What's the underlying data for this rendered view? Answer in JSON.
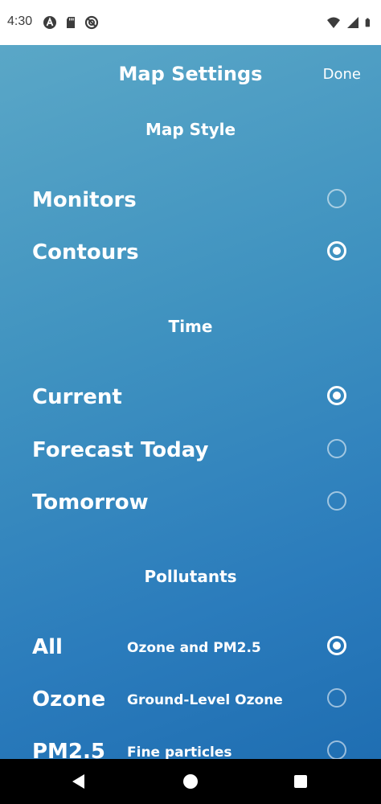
{
  "status_bar": {
    "time": "4:30",
    "left_icons": [
      "a-icon",
      "sd-card-icon",
      "sync-icon"
    ],
    "right_icons": [
      "wifi-icon",
      "signal-icon",
      "battery-icon"
    ]
  },
  "header": {
    "title": "Map Settings",
    "done_label": "Done"
  },
  "sections": {
    "map_style": {
      "title": "Map Style",
      "options": [
        {
          "label": "Monitors",
          "selected": false
        },
        {
          "label": "Contours",
          "selected": true
        }
      ]
    },
    "time": {
      "title": "Time",
      "options": [
        {
          "label": "Current",
          "selected": true
        },
        {
          "label": "Forecast Today",
          "selected": false
        },
        {
          "label": "Tomorrow",
          "selected": false
        }
      ]
    },
    "pollutants": {
      "title": "Pollutants",
      "options": [
        {
          "label": "All",
          "description": "Ozone and PM2.5",
          "selected": true
        },
        {
          "label": "Ozone",
          "description": "Ground-Level Ozone",
          "selected": false
        },
        {
          "label": "PM2.5",
          "description": "Fine particles",
          "selected": false
        }
      ]
    }
  },
  "colors": {
    "gradient_start": "#5aa7c7",
    "gradient_end": "#1f6eb2",
    "text": "#ffffff",
    "nav_bar": "#000000"
  }
}
